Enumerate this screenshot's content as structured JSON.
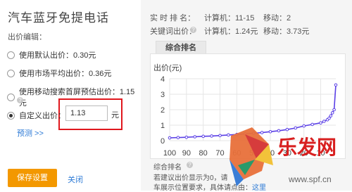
{
  "title": "汽车蓝牙免提电话",
  "bid_edit_label": "出价编辑：",
  "options": [
    {
      "label": "使用默认出价：0.30元",
      "selected": false
    },
    {
      "label": "使用市场平均出价：0.36元",
      "selected": false
    },
    {
      "label": "使用移动搜索首屏预估出价：1.15元",
      "selected": false
    },
    {
      "label": "自定义出价：",
      "selected": true
    }
  ],
  "custom_bid": {
    "value": "1.13",
    "unit": "元"
  },
  "forecast_link": "预测 >>",
  "buttons": {
    "save": "保存设置",
    "close": "关闭"
  },
  "stats": {
    "realtime_rank_label": "实 时 排 名：",
    "rank_computer": "计算机：11-15",
    "rank_mobile": "移动：2",
    "keyword_bid_label": "关键词出价：",
    "bid_computer": "计算机：1.24元",
    "bid_mobile": "移动：3.73元"
  },
  "chart_tab": "综合排名",
  "chart_data": {
    "type": "line",
    "ylabel": "出价(元)",
    "yticks": [
      "0",
      "1",
      "2",
      "3",
      "4"
    ],
    "xticks": [
      "100",
      "90",
      "80",
      "70",
      "60",
      "50",
      "40",
      "30",
      "20",
      "10"
    ],
    "ylim": [
      0,
      4
    ],
    "xlim": [
      100,
      1
    ],
    "series": [
      {
        "x": [
          100,
          95,
          90,
          85,
          80,
          75,
          70,
          65,
          60,
          55,
          50,
          45,
          40,
          35,
          30,
          25,
          20,
          15,
          10,
          8,
          6,
          5,
          4,
          3,
          2,
          1
        ],
        "y": [
          0.18,
          0.2,
          0.22,
          0.25,
          0.28,
          0.3,
          0.33,
          0.37,
          0.4,
          0.44,
          0.48,
          0.52,
          0.58,
          0.64,
          0.72,
          0.82,
          0.95,
          1.05,
          1.15,
          1.25,
          1.35,
          1.45,
          1.6,
          1.8,
          2.0,
          3.6
        ]
      }
    ],
    "color": "#5a3fe6"
  },
  "bottom": {
    "rank_label": "综合排名",
    "line1": "若建议出价显示为0，请",
    "line1b": "",
    "line2": "车展示位置要求，具体请点由：",
    "line2_link": "这里"
  },
  "watermark": {
    "brand": "乐发网",
    "url": "www.spf.cn"
  }
}
